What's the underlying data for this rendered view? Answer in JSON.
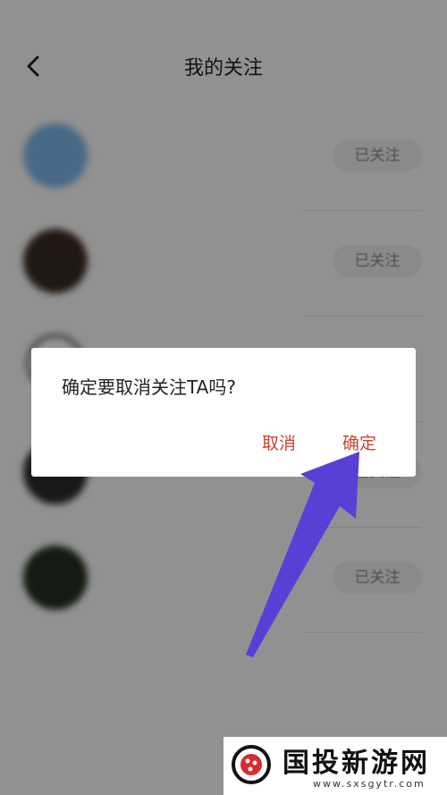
{
  "header": {
    "title": "我的关注"
  },
  "list": {
    "follow_label": "已关注",
    "items": [
      {
        "name": "",
        "sub": ""
      },
      {
        "name": "",
        "sub": ""
      },
      {
        "name": "",
        "sub": ""
      },
      {
        "name": "",
        "sub": ""
      },
      {
        "name": "",
        "sub": ""
      }
    ]
  },
  "dialog": {
    "message": "确定要取消关注TA吗?",
    "cancel_label": "取消",
    "confirm_label": "确定"
  },
  "watermark": {
    "brand": "国投新游网",
    "url": "www.sxsgytr.com"
  },
  "colors": {
    "accent": "#c8432f",
    "annotation_arrow": "#5a3fd6"
  }
}
